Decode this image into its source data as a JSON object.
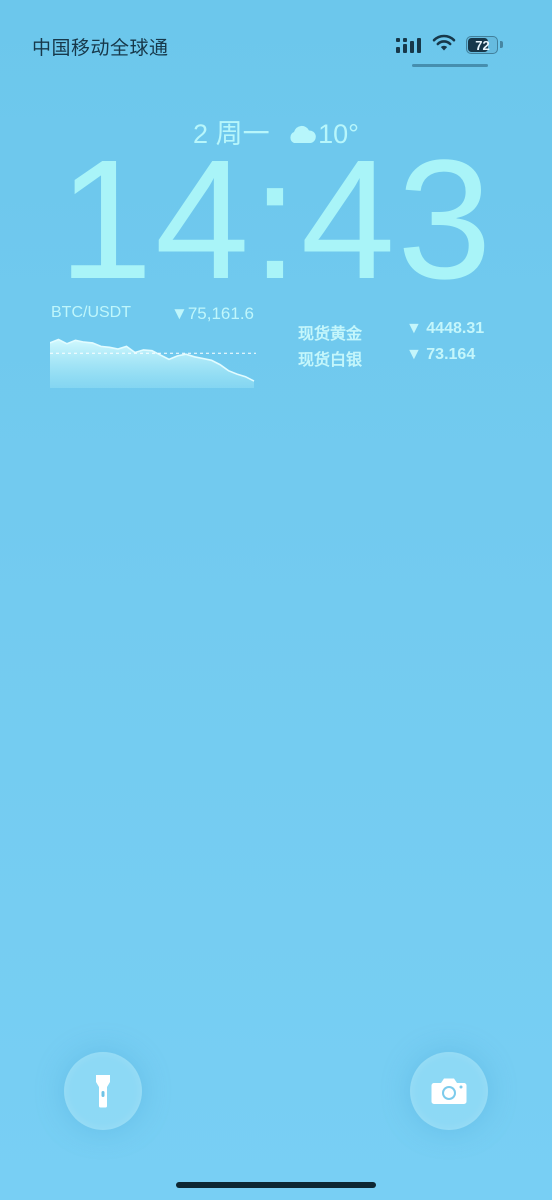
{
  "status_bar": {
    "carrier": "中国移动全球通",
    "battery_level": "72",
    "battery_fraction": 0.72,
    "signal_icon": "cellular-signal-icon",
    "wifi_icon": "wifi-icon"
  },
  "lock_screen": {
    "date_text": "2 周一",
    "weather_icon": "cloud-icon",
    "temperature": "10°",
    "time": "14:43"
  },
  "btc_widget": {
    "pair": "BTC/USDT",
    "price": "▼75,161.6",
    "chart_data": {
      "type": "area",
      "values": [
        62,
        66,
        61,
        65,
        63,
        62,
        58,
        57,
        55,
        58,
        51,
        54,
        53,
        48,
        43,
        47,
        49,
        46,
        44,
        42,
        37,
        30,
        26,
        23,
        18
      ],
      "baseline": 50
    }
  },
  "metals": [
    {
      "name": "现货黄金",
      "value": "▼ 4448.31"
    },
    {
      "name": "现货白银",
      "value": "▼ 73.164"
    }
  ],
  "controls": {
    "flashlight_icon": "flashlight-icon",
    "camera_icon": "camera-icon"
  },
  "colors": {
    "background": "#74ccf1",
    "clock_text": "#a9f4f8",
    "status_text": "#17384a"
  }
}
